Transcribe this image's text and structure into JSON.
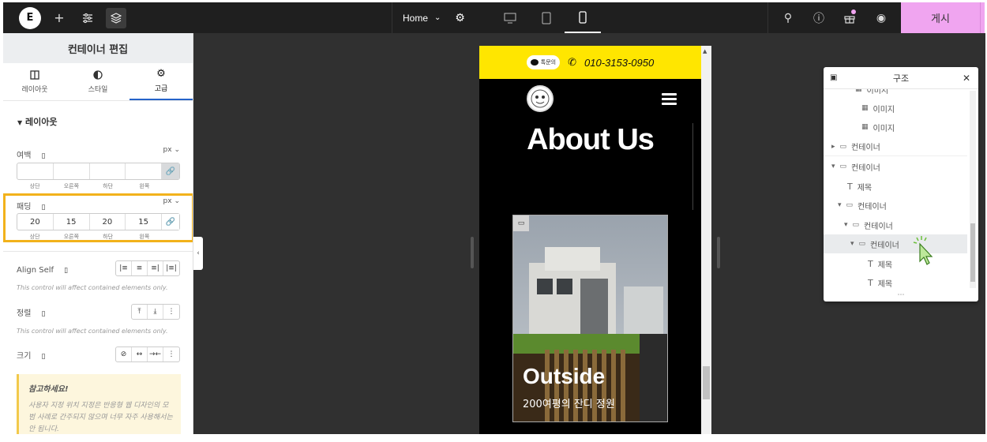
{
  "toolbar": {
    "home_label": "Home",
    "publish_label": "게시"
  },
  "panel": {
    "title": "컨테이너 편집",
    "tabs": [
      {
        "label": "레이아웃",
        "icon": "layout-icon"
      },
      {
        "label": "스타일",
        "icon": "style-icon"
      },
      {
        "label": "고급",
        "icon": "gear-icon"
      }
    ],
    "section_title": "레이아웃",
    "margin": {
      "label": "여백",
      "unit": "px",
      "values": [
        "",
        "",
        "",
        ""
      ]
    },
    "padding": {
      "label": "패딩",
      "unit": "px",
      "values": [
        "20",
        "15",
        "20",
        "15"
      ]
    },
    "sides": [
      "상단",
      "오른쪽",
      "하단",
      "왼쪽"
    ],
    "align_self": {
      "label": "Align Self",
      "note": "This control will affect contained elements only."
    },
    "order": {
      "label": "정렬",
      "note": "This control will affect contained elements only."
    },
    "size": {
      "label": "크기"
    },
    "alert": {
      "title": "참고하세요!",
      "text": "사용자 지정 위치 지정은 반응형 웹 디자인의 모범 사례로 간주되지 않으며 너무 자주 사용해서는 안 됩니다."
    }
  },
  "preview": {
    "topbar_badge": "톡문의",
    "phone": "010-3153-0950",
    "heading": "About Us",
    "card_title": "Outside",
    "card_subtitle": "200여평의 잔디 정원"
  },
  "structure": {
    "title": "구조",
    "items": [
      {
        "label": "이미지",
        "icon": "image-icon"
      },
      {
        "label": "이미지",
        "icon": "image-icon"
      },
      {
        "label": "컨테이너",
        "icon": "container-icon"
      },
      {
        "label": "컨테이너",
        "icon": "container-icon"
      },
      {
        "label": "제목",
        "icon": "heading-icon"
      },
      {
        "label": "컨테이너",
        "icon": "container-icon"
      },
      {
        "label": "컨테이너",
        "icon": "container-icon"
      },
      {
        "label": "컨테이너",
        "icon": "container-icon"
      },
      {
        "label": "제목",
        "icon": "heading-icon"
      },
      {
        "label": "제목",
        "icon": "heading-icon"
      }
    ]
  },
  "colors": {
    "accent": "#f0a5f0",
    "highlight": "#f2b21b",
    "banner": "#ffe600"
  }
}
